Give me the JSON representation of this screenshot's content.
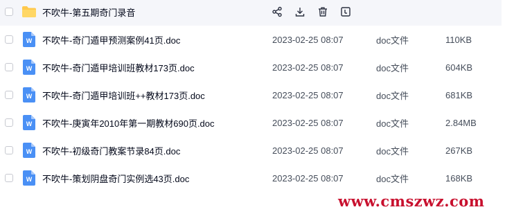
{
  "folder": {
    "name": "不吹牛-第五期奇门录音",
    "icon": "folder-icon",
    "actions": [
      {
        "icon": "share-icon"
      },
      {
        "icon": "download-icon"
      },
      {
        "icon": "delete-icon"
      },
      {
        "icon": "more-icon"
      }
    ]
  },
  "files": [
    {
      "name": "不吹牛-奇门遁甲预测案例41页.doc",
      "date": "2023-02-25 08:07",
      "type": "doc文件",
      "size": "110KB",
      "icon": "word-doc-icon"
    },
    {
      "name": "不吹牛-奇门遁甲培训班教材173页.doc",
      "date": "2023-02-25 08:07",
      "type": "doc文件",
      "size": "604KB",
      "icon": "word-doc-icon"
    },
    {
      "name": "不吹牛-奇门遁甲培训班++教材173页.doc",
      "date": "2023-02-25 08:07",
      "type": "doc文件",
      "size": "681KB",
      "icon": "word-doc-icon"
    },
    {
      "name": "不吹牛-庚寅年2010年第一期教材690页.doc",
      "date": "2023-02-25 08:07",
      "type": "doc文件",
      "size": "2.84MB",
      "icon": "word-doc-icon"
    },
    {
      "name": "不吹牛-初级奇门教案节录84页.doc",
      "date": "2023-02-25 08:07",
      "type": "doc文件",
      "size": "267KB",
      "icon": "word-doc-icon"
    },
    {
      "name": "不吹牛-策划阴盘奇门实例选43页.doc",
      "date": "2023-02-25 08:07",
      "type": "doc文件",
      "size": "168KB",
      "icon": "word-doc-icon"
    }
  ],
  "watermark": "www.cmszwz.com",
  "colors": {
    "folder": "#ffc94d",
    "word": "#4a90f5",
    "watermark": "#c8102e",
    "hover_bg": "#f5f6fa"
  }
}
